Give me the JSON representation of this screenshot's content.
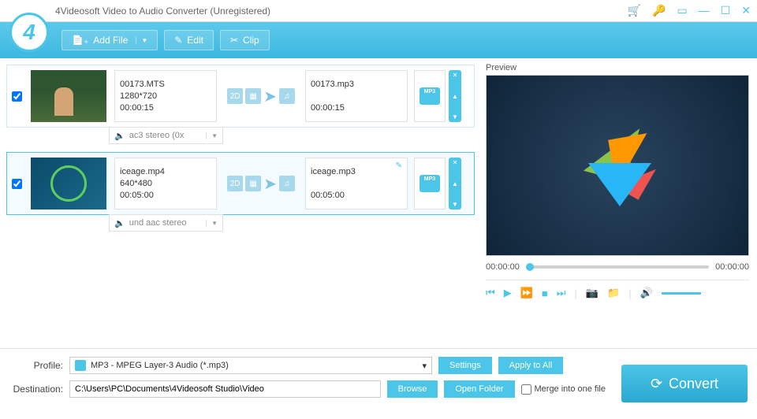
{
  "title": "4Videosoft Video to Audio Converter (Unregistered)",
  "toolbar": {
    "add_file": "Add File",
    "edit": "Edit",
    "clip": "Clip"
  },
  "files": [
    {
      "checked": true,
      "selected": false,
      "thumb_class": "forest",
      "src_name": "00173.MTS",
      "resolution": "1280*720",
      "src_duration": "00:00:15",
      "out_name": "00173.mp3",
      "out_duration": "00:00:15",
      "audio_track": "ac3 stereo (0x",
      "show_edit": false
    },
    {
      "checked": true,
      "selected": true,
      "thumb_class": "iceage",
      "src_name": "iceage.mp4",
      "resolution": "640*480",
      "src_duration": "00:05:00",
      "out_name": "iceage.mp3",
      "out_duration": "00:05:00",
      "audio_track": "und aac stereo",
      "show_edit": true
    }
  ],
  "preview": {
    "label": "Preview",
    "time_current": "00:00:00",
    "time_total": "00:00:00"
  },
  "bottom": {
    "profile_label": "Profile:",
    "profile_value": "MP3 - MPEG Layer-3 Audio (*.mp3)",
    "destination_label": "Destination:",
    "destination_value": "C:\\Users\\PC\\Documents\\4Videosoft Studio\\Video",
    "settings": "Settings",
    "apply_all": "Apply to All",
    "browse": "Browse",
    "open_folder": "Open Folder",
    "merge": "Merge into one file",
    "convert": "Convert"
  },
  "icons": {
    "pipe_2d": "2D",
    "speaker": "🔊",
    "note": "♫"
  }
}
